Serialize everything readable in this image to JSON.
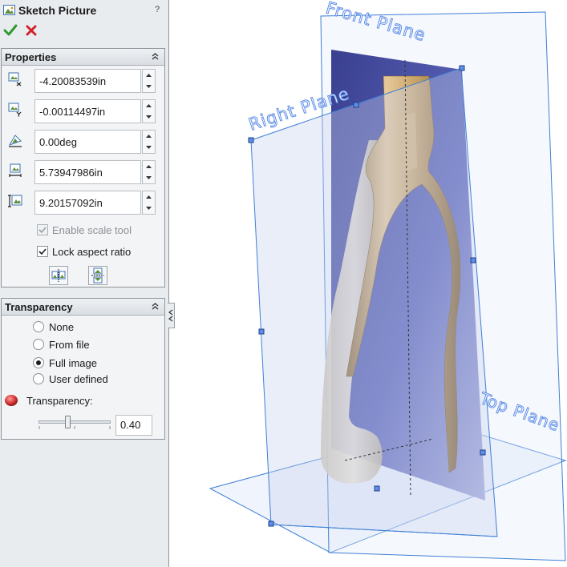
{
  "panel": {
    "title": "Sketch Picture",
    "help": "?"
  },
  "properties": {
    "header": "Properties",
    "fields": [
      {
        "name": "origin-x",
        "value": "-4.20083539in"
      },
      {
        "name": "origin-y",
        "value": "-0.00114497in"
      },
      {
        "name": "angle",
        "value": "0.00deg"
      },
      {
        "name": "width",
        "value": "5.73947986in"
      },
      {
        "name": "height",
        "value": "9.20157092in"
      }
    ],
    "enable_scale_tool": {
      "label": "Enable scale tool",
      "checked": true,
      "enabled": false
    },
    "lock_aspect_ratio": {
      "label": "Lock aspect ratio",
      "checked": true,
      "enabled": true
    }
  },
  "transparency": {
    "header": "Transparency",
    "options": [
      "None",
      "From file",
      "Full image",
      "User defined"
    ],
    "selected": "Full image",
    "slider_label": "Transparency:",
    "slider_value": "0.40",
    "slider_fraction": 0.4
  },
  "viewport": {
    "planes": {
      "front": "Front Plane",
      "right": "Right Plane",
      "top": "Top Plane"
    }
  },
  "colors": {
    "accent_plane": "#3f7fd6",
    "plane_label": "#5f8ee8",
    "part": "#c9a46a",
    "check": "#2f9a2f",
    "cross": "#d0242a"
  }
}
